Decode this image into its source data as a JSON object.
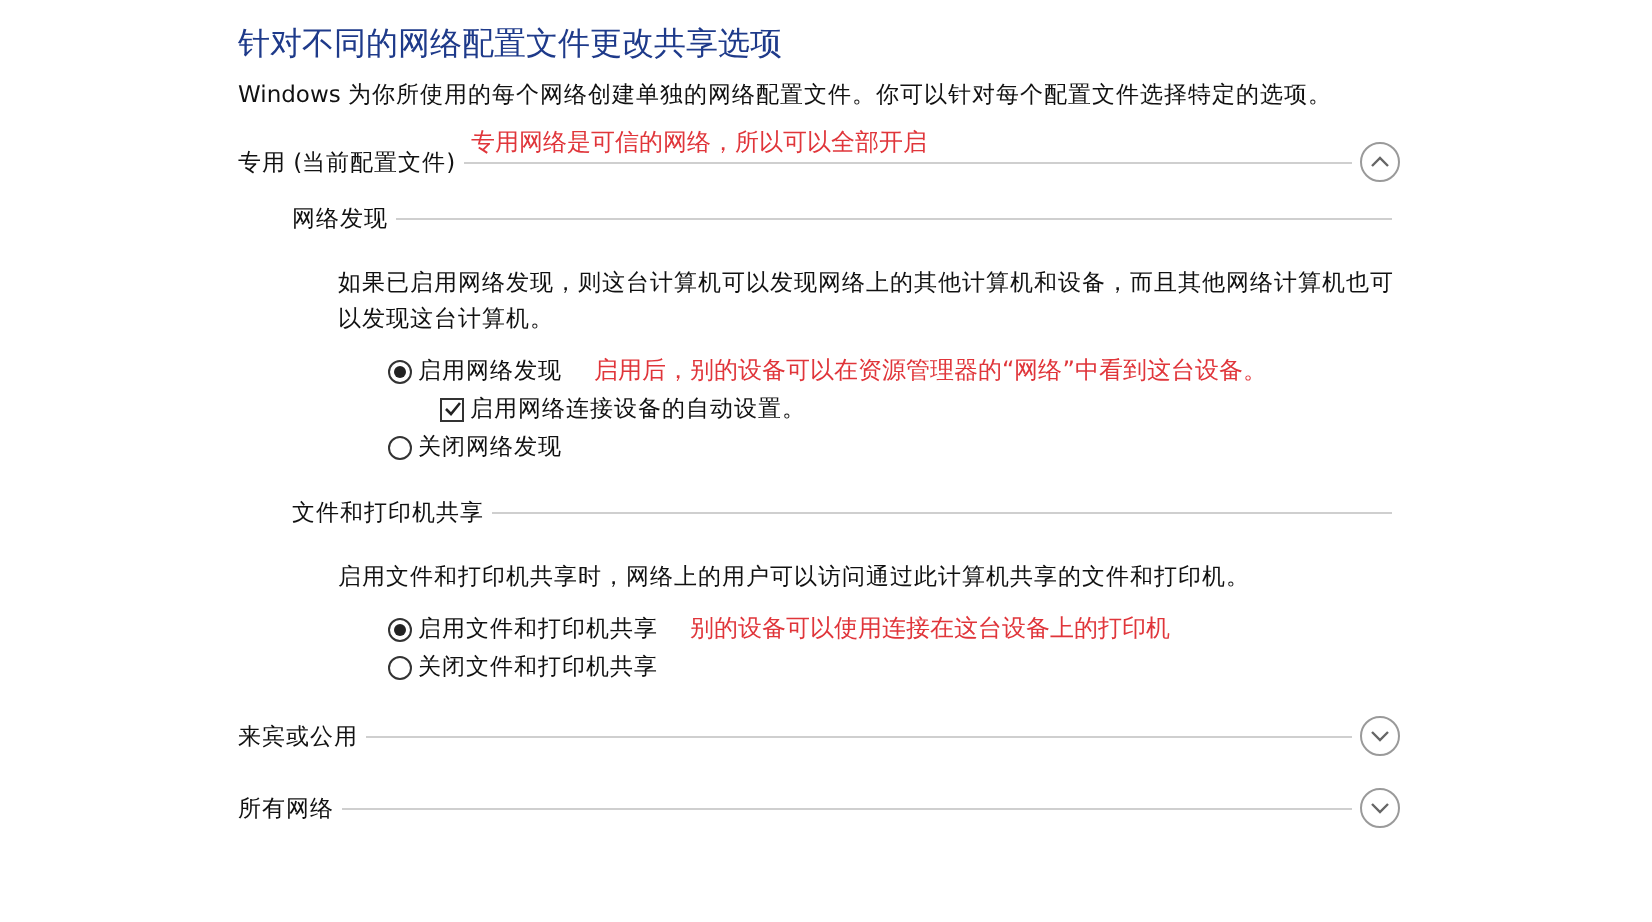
{
  "title": "针对不同的网络配置文件更改共享选项",
  "description": "Windows 为你所使用的每个网络创建单独的网络配置文件。你可以针对每个配置文件选择特定的选项。",
  "profiles": [
    {
      "label": "专用 (当前配置文件)",
      "expanded": true,
      "note": "专用网络是可信的网络，所以可以全部开启",
      "sections": [
        {
          "heading": "网络发现",
          "description": "如果已启用网络发现，则这台计算机可以发现网络上的其他计算机和设备，而且其他网络计算机也可以发现这台计算机。",
          "options": [
            {
              "kind": "radio",
              "label": "启用网络发现",
              "selected": true,
              "note": "启用后，别的设备可以在资源管理器的“网络”中看到这台设备。"
            },
            {
              "kind": "checkbox",
              "label": "启用网络连接设备的自动设置。",
              "checked": true
            },
            {
              "kind": "radio",
              "label": "关闭网络发现",
              "selected": false
            }
          ]
        },
        {
          "heading": "文件和打印机共享",
          "description": "启用文件和打印机共享时，网络上的用户可以访问通过此计算机共享的文件和打印机。",
          "options": [
            {
              "kind": "radio",
              "label": "启用文件和打印机共享",
              "selected": true,
              "note": "别的设备可以使用连接在这台设备上的打印机"
            },
            {
              "kind": "radio",
              "label": "关闭文件和打印机共享",
              "selected": false
            }
          ]
        }
      ]
    },
    {
      "label": "来宾或公用",
      "expanded": false
    },
    {
      "label": "所有网络",
      "expanded": false
    }
  ]
}
